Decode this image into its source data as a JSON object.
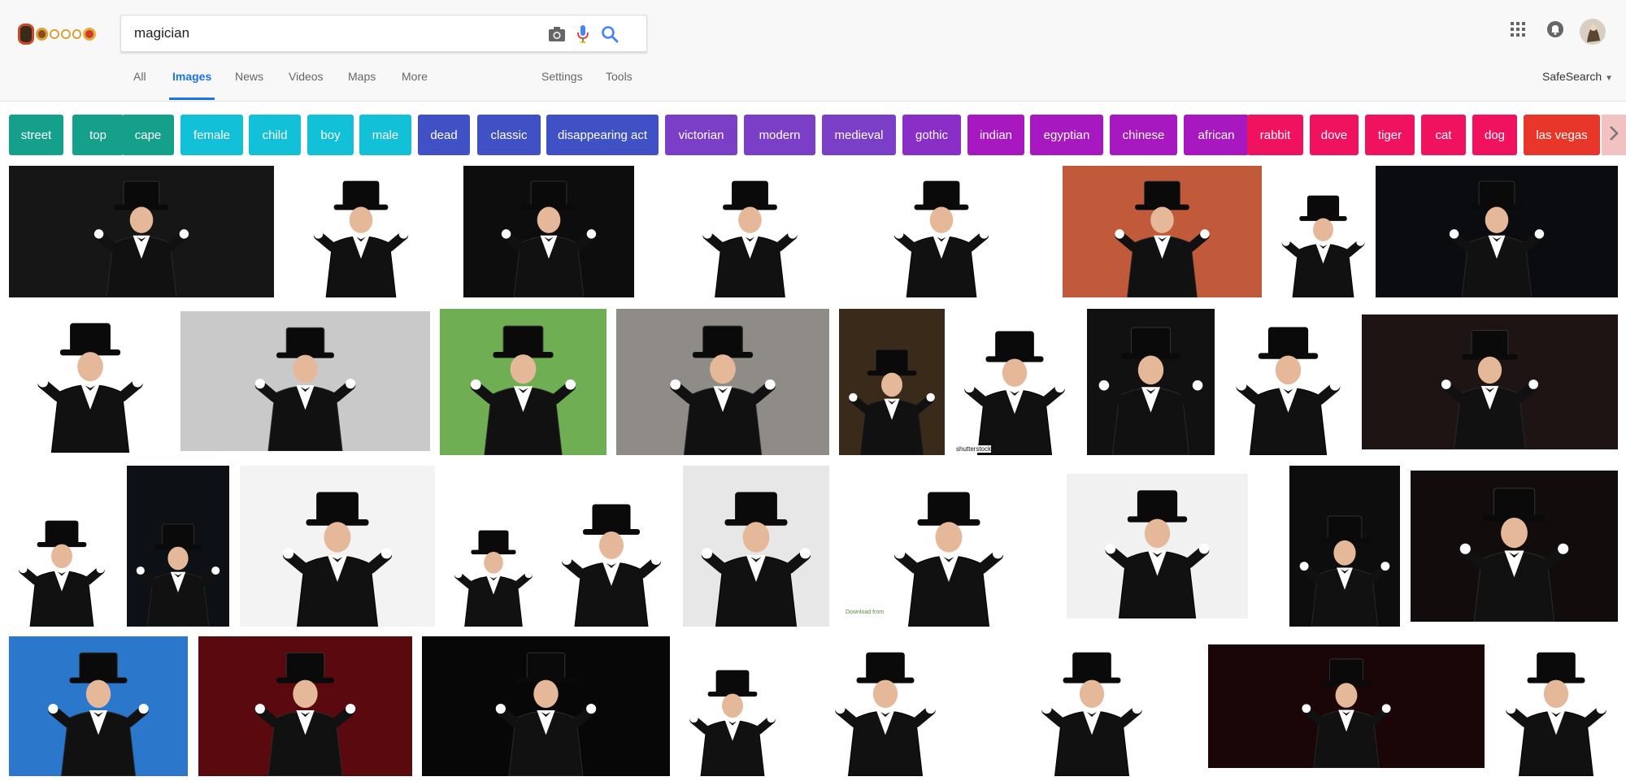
{
  "search": {
    "query": "magician"
  },
  "nav": {
    "tabs": [
      {
        "label": "All"
      },
      {
        "label": "Images"
      },
      {
        "label": "News"
      },
      {
        "label": "Videos"
      },
      {
        "label": "Maps"
      },
      {
        "label": "More"
      }
    ],
    "settings": "Settings",
    "tools": "Tools",
    "safesearch": "SafeSearch"
  },
  "chips": [
    {
      "label": "street",
      "color": "#15a08c"
    },
    {
      "label": "top",
      "color": "#15a08c"
    },
    {
      "label": "cape",
      "color": "#15a08c"
    },
    {
      "label": "female",
      "color": "#12c0d8"
    },
    {
      "label": "child",
      "color": "#12c0d8"
    },
    {
      "label": "boy",
      "color": "#12c0d8"
    },
    {
      "label": "male",
      "color": "#12c0d8"
    },
    {
      "label": "dead",
      "color": "#3f51c4"
    },
    {
      "label": "classic",
      "color": "#3f51c4"
    },
    {
      "label": "disappearing act",
      "color": "#3f51c4"
    },
    {
      "label": "victorian",
      "color": "#7b3ec6"
    },
    {
      "label": "modern",
      "color": "#7b3ec6"
    },
    {
      "label": "medieval",
      "color": "#7b3ec6"
    },
    {
      "label": "gothic",
      "color": "#8b2ec8"
    },
    {
      "label": "indian",
      "color": "#a818c0"
    },
    {
      "label": "egyptian",
      "color": "#a818c0"
    },
    {
      "label": "chinese",
      "color": "#a818c0"
    },
    {
      "label": "african",
      "color": "#a818c0"
    },
    {
      "label": "rabbit",
      "color": "#f0125e"
    },
    {
      "label": "dove",
      "color": "#f0125e"
    },
    {
      "label": "tiger",
      "color": "#f0125e"
    },
    {
      "label": "cat",
      "color": "#f0125e"
    },
    {
      "label": "dog",
      "color": "#f0125e"
    },
    {
      "label": "las vegas",
      "color": "#e8362a"
    }
  ],
  "images": {
    "watermark_1": "shutterstock",
    "watermark_2": "Download from"
  }
}
